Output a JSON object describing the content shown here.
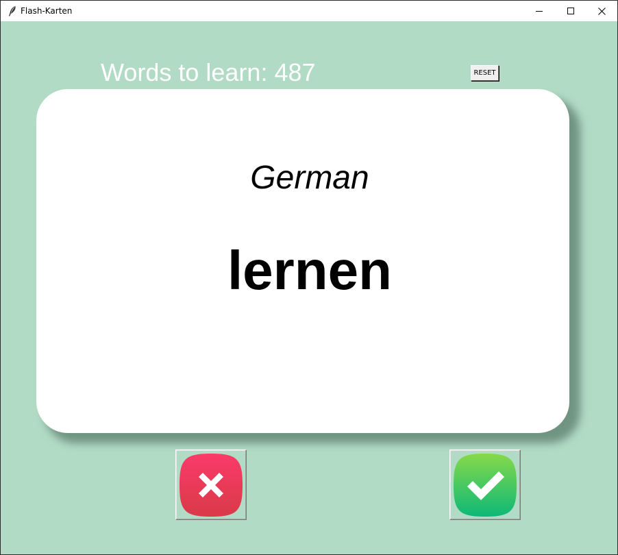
{
  "window": {
    "title": "Flash-Karten",
    "icon": "feather-icon",
    "controls": [
      "minimize-icon",
      "maximize-icon",
      "close-icon"
    ]
  },
  "counter": {
    "text": "Words to learn: 487"
  },
  "reset_button": {
    "label": "RESET"
  },
  "card": {
    "language": "German",
    "word": "lernen"
  },
  "answer_buttons": {
    "wrong": {
      "icon": "cross-icon",
      "color": "#e8365a"
    },
    "right": {
      "icon": "checkmark-icon",
      "color": "#1fbf6a"
    }
  },
  "colors": {
    "background": "#b1dbc5",
    "card": "#ffffff",
    "counter_text": "#ffffff"
  }
}
